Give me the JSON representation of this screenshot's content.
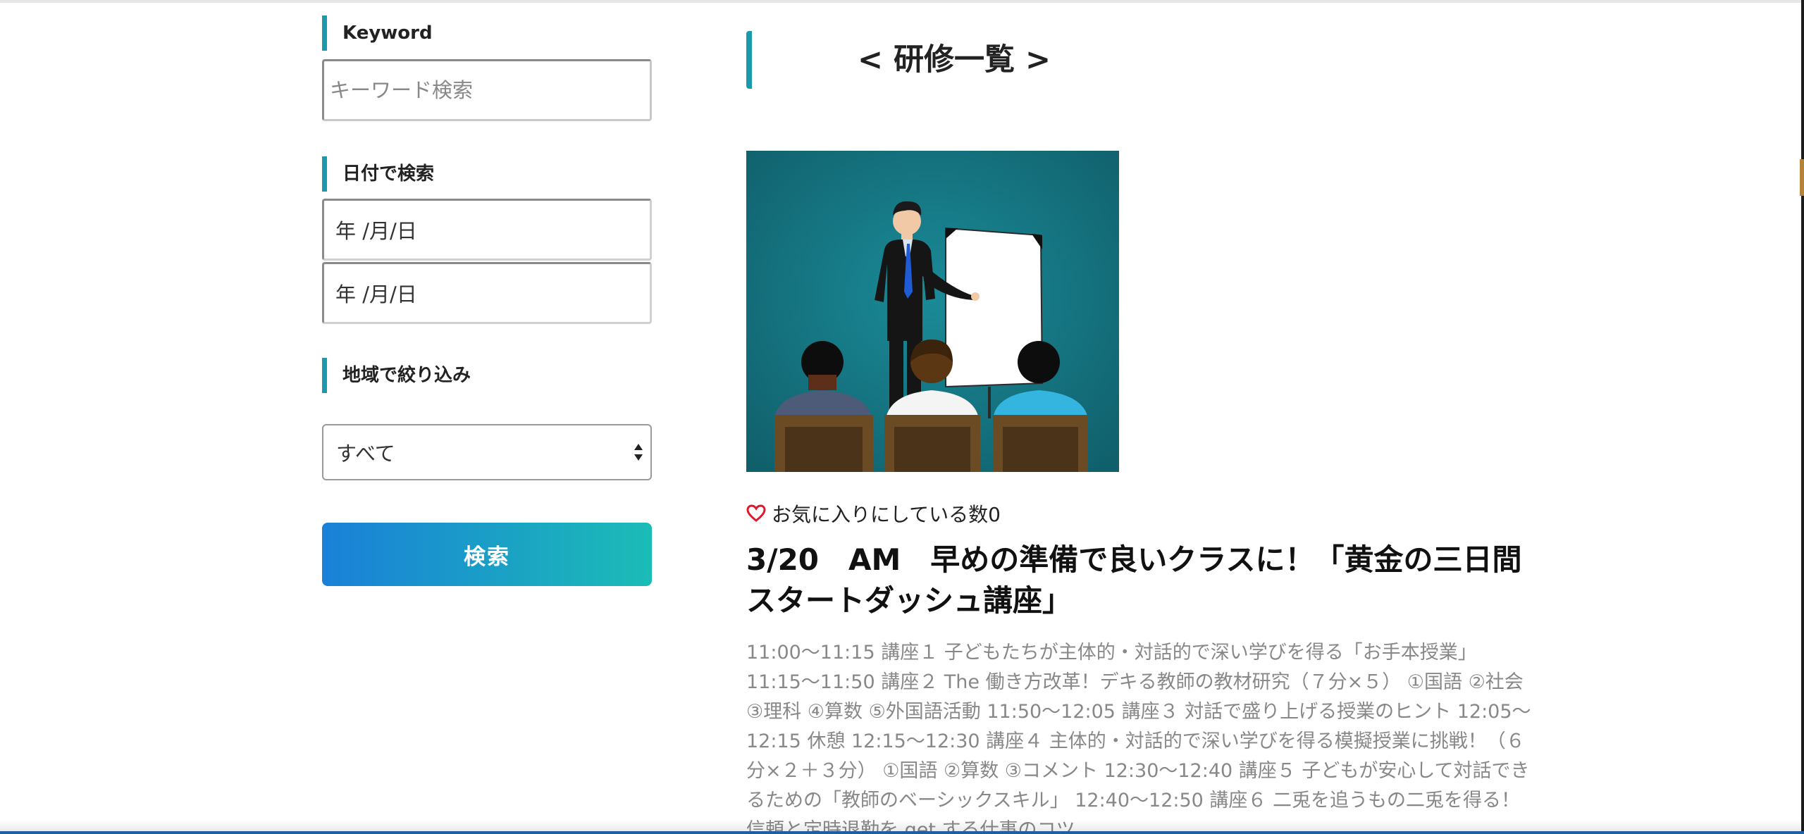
{
  "sidebar": {
    "keyword": {
      "title": "Keyword",
      "placeholder": "キーワード検索"
    },
    "date": {
      "title": "日付で検索",
      "from_value": "年 /月/日",
      "to_value": "年 /月/日"
    },
    "region": {
      "title": "地域で絞り込み",
      "selected": "すべて"
    },
    "search_button_label": "検索"
  },
  "main": {
    "heading": "< 研修一覧 >",
    "post": {
      "thumbnail_icon": "presentation-illustration",
      "favorite_label": "お気に入りにしている数0",
      "title": "3/20　AM　早めの準備で良いクラスに！「黄金の三日間スタートダッシュ講座」",
      "excerpt": "11:00〜11:15 講座１ 子どもたちが主体的・対話的で深い学びを得る「お手本授業」 11:15〜11:50 講座２ The 働き方改革！デキる教師の教材研究（７分×５） ①国語 ②社会 ③理科 ④算数 ⑤外国語活動 11:50〜12:05 講座３ 対話で盛り上げる授業のヒント 12:05〜12:15 休憩 12:15〜12:30 講座４ 主体的・対話的で深い学びを得る模擬授業に挑戦！（６分×２＋３分） ①国語 ②算数 ③コメント 12:30〜12:40 講座５ 子どもが安心して対話できるための「教師のベーシックスキル」 12:40〜12:50 講座６ 二兎を追うもの二兎を得る！信頼と定時退勤を get する仕事のコツ"
    }
  },
  "colors": {
    "accent": "#1a9aaa",
    "button_gradient_start": "#1a80d8",
    "button_gradient_end": "#1bbcb6",
    "heart": "#e0182b",
    "excerpt_text": "#888888"
  }
}
